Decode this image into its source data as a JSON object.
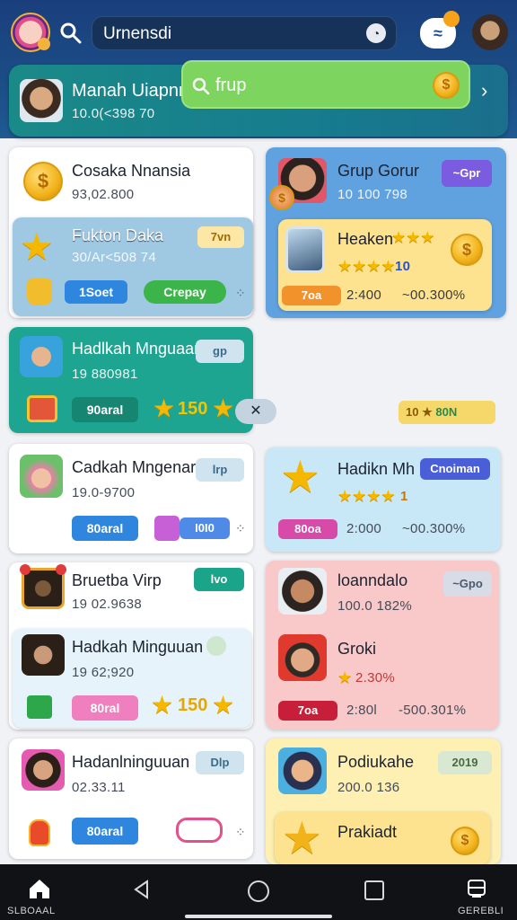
{
  "header": {
    "search_value": "Urnensdi",
    "search_icon": "search-icon",
    "chat_badge": "",
    "brand_color": "#1b4c86"
  },
  "banner": {
    "name": "Manah Uiapnr",
    "sub": "10.0(<398 70",
    "pill_text": "frup"
  },
  "cards": {
    "c1": {
      "title": "Cosaka Nnansia",
      "sub": "93,02.800"
    },
    "c1b": {
      "title": "Fukton Daka",
      "sub": "30/Ar<508 74",
      "badge": "7vn",
      "btn1": "1Soet",
      "btn2": "Crepay"
    },
    "c2": {
      "title": "Grup Gorur",
      "sub": "10 100 798",
      "badge": "~Gpr"
    },
    "c2b": {
      "title": "Heaken",
      "rating": "10",
      "pill": "7oa",
      "v1": "2:400",
      "v2": "~00.300%"
    },
    "c3": {
      "title": "Hadlkah Mnguaar",
      "sub": "19 880981",
      "badge": "gp",
      "btn": "90aral",
      "num": "150"
    },
    "c3b": {
      "left": "10",
      "right": "80N"
    },
    "c4": {
      "title": "Cadkah Mngenar",
      "sub": "19.0-9700",
      "badge": "lrp",
      "btn": "80aral",
      "extra": "I0I0"
    },
    "c5": {
      "title": "Hadikn Mh",
      "badge": "Cnoiman",
      "rating": "1",
      "pill": "80oa",
      "v1": "2:000",
      "v2": "~00.300%"
    },
    "c6": {
      "title": "Bruetba Virp",
      "sub": "19 02.9638",
      "badge": "lvo"
    },
    "c6b": {
      "title": "Hadkah Minguuan",
      "sub": "19 62;920",
      "btn": "80ral",
      "num": "150"
    },
    "c7": {
      "title": "loanndalo",
      "sub": "100.0 182%",
      "badge": "~Gpo"
    },
    "c7b": {
      "title": "Groki",
      "rating": "2.30%",
      "pill": "7oa",
      "v1": "2:80l",
      "v2": "-500.301%"
    },
    "c8": {
      "title": "Hadanlninguuan",
      "sub": "02.33.11",
      "badge": "Dlp",
      "btn": "80aral"
    },
    "c9": {
      "title": "Podiukahe",
      "sub": "200.0 136",
      "badge": "2019"
    },
    "c9b": {
      "title": "Prakiadt"
    }
  },
  "nav": {
    "left_label": "SLBOAAL",
    "right_label": "GEREBLI"
  }
}
